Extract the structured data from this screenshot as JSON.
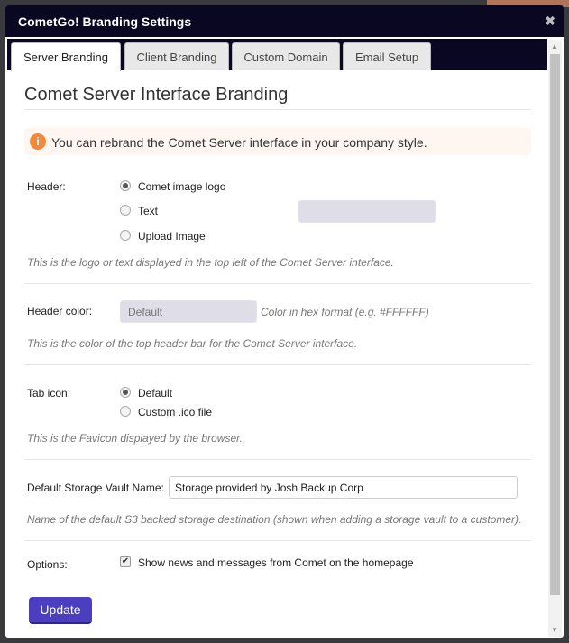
{
  "dialog": {
    "title": "CometGo! Branding Settings",
    "close_icon": "close-icon"
  },
  "tabs": [
    {
      "label": "Server Branding",
      "active": true
    },
    {
      "label": "Client Branding"
    },
    {
      "label": "Custom Domain"
    },
    {
      "label": "Email Setup"
    }
  ],
  "section_title": "Comet Server Interface Branding",
  "alert": {
    "icon": "info-icon",
    "text": "You can rebrand the Comet Server interface in your company style.",
    "color": "#f0883e"
  },
  "header": {
    "label": "Header:",
    "options": [
      "Comet image logo",
      "Text",
      "Upload Image"
    ],
    "selected": "Comet image logo",
    "text_value": "",
    "help": "This is the logo or text displayed in the top left of the Comet Server interface."
  },
  "header_color": {
    "label": "Header color:",
    "placeholder": "Default",
    "hint": "Color in hex format (e.g. #FFFFFF)",
    "help": "This is the color of the top header bar for the Comet Server interface."
  },
  "tab_icon": {
    "label": "Tab icon:",
    "options": [
      "Default",
      "Custom .ico file"
    ],
    "selected": "Default",
    "help": "This is the Favicon displayed by the browser."
  },
  "vault": {
    "label": "Default Storage Vault Name:",
    "value": "Storage provided by Josh Backup Corp",
    "help": "Name of the default S3 backed storage destination (shown when adding a storage vault to a customer)."
  },
  "options": {
    "label": "Options:",
    "checkbox_label": "Show news and messages from Comet on the homepage",
    "checked": true
  },
  "update_label": "Update",
  "colors": {
    "titlebar": "#0a0723",
    "button": "#4b3fbf"
  }
}
